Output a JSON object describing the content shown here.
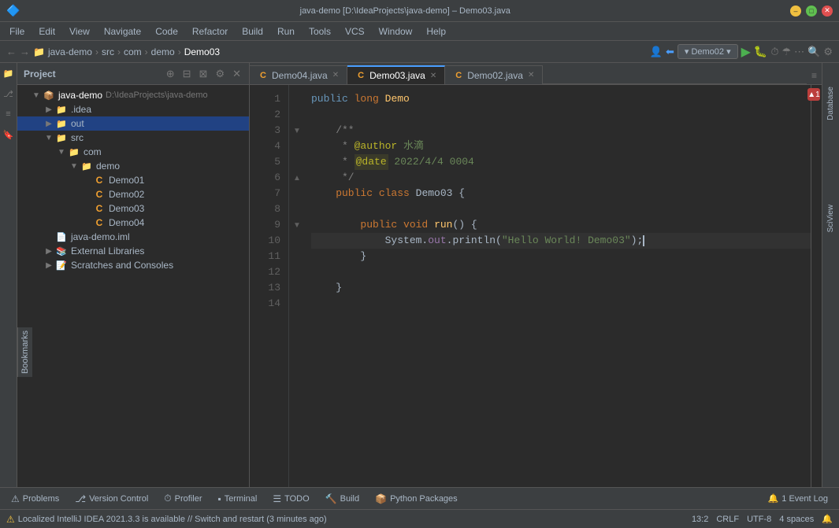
{
  "titleBar": {
    "title": "java-demo [D:\\IdeaProjects\\java-demo] – Demo03.java",
    "appName": "IntelliJ IDEA"
  },
  "menuBar": {
    "items": [
      "File",
      "Edit",
      "View",
      "Navigate",
      "Code",
      "Refactor",
      "Build",
      "Run",
      "Tools",
      "VCS",
      "Window",
      "Help"
    ]
  },
  "navBar": {
    "breadcrumb": [
      "java-demo",
      "src",
      "com",
      "demo",
      "Demo03"
    ],
    "separators": [
      ">",
      ">",
      ">",
      ">"
    ],
    "config": "Demo02",
    "buttons": {
      "run": "▶",
      "debug": "🐛",
      "profile": "⏱",
      "coverage": "☂"
    }
  },
  "projectPanel": {
    "title": "Project",
    "root": "java-demo",
    "rootPath": "D:\\IdeaProjects\\java-demo",
    "items": [
      {
        "level": 1,
        "label": ".idea",
        "type": "folder",
        "expanded": false
      },
      {
        "level": 1,
        "label": "out",
        "type": "folder",
        "expanded": false,
        "selected": true
      },
      {
        "level": 1,
        "label": "src",
        "type": "folder",
        "expanded": true
      },
      {
        "level": 2,
        "label": "com",
        "type": "folder",
        "expanded": true
      },
      {
        "level": 3,
        "label": "demo",
        "type": "folder",
        "expanded": true
      },
      {
        "level": 4,
        "label": "Demo01",
        "type": "java"
      },
      {
        "level": 4,
        "label": "Demo02",
        "type": "java"
      },
      {
        "level": 4,
        "label": "Demo03",
        "type": "java"
      },
      {
        "level": 4,
        "label": "Demo04",
        "type": "java"
      },
      {
        "level": 1,
        "label": "java-demo.iml",
        "type": "iml"
      },
      {
        "level": 1,
        "label": "External Libraries",
        "type": "lib",
        "expanded": false
      },
      {
        "level": 1,
        "label": "Scratches and Consoles",
        "type": "folder",
        "expanded": false
      }
    ]
  },
  "tabs": [
    {
      "label": "Demo04.java",
      "icon": "java",
      "active": false,
      "closable": true
    },
    {
      "label": "Demo03.java",
      "icon": "java",
      "active": true,
      "closable": true
    },
    {
      "label": "Demo02.java",
      "icon": "java",
      "active": false,
      "closable": true
    }
  ],
  "editor": {
    "filename": "Demo03.java",
    "lines": [
      {
        "num": 1,
        "text": "    ",
        "tokens": [
          {
            "type": "plain",
            "text": "    "
          }
        ],
        "fold": false
      },
      {
        "num": 2,
        "text": "",
        "tokens": [],
        "fold": false
      },
      {
        "num": 3,
        "text": "    /**",
        "tokens": [
          {
            "type": "comment",
            "text": "    /**"
          }
        ],
        "fold": true
      },
      {
        "num": 4,
        "text": "     * @author 水滴",
        "tokens": [
          {
            "type": "comment",
            "text": "     * "
          },
          {
            "type": "anno",
            "text": "@author"
          },
          {
            "type": "anno-val",
            "text": " 水滴"
          }
        ],
        "fold": false
      },
      {
        "num": 5,
        "text": "     * @date 2022/4/4 0004",
        "tokens": [
          {
            "type": "comment",
            "text": "     * "
          },
          {
            "type": "anno-hl",
            "text": "@date"
          },
          {
            "type": "anno-val",
            "text": " 2022/4/4 0004"
          }
        ],
        "fold": false
      },
      {
        "num": 6,
        "text": "     */",
        "tokens": [
          {
            "type": "comment",
            "text": "     */"
          }
        ],
        "fold": true
      },
      {
        "num": 7,
        "text": "    public class Demo03 {",
        "tokens": [
          {
            "type": "plain",
            "text": "    "
          },
          {
            "type": "kw",
            "text": "public"
          },
          {
            "type": "plain",
            "text": " "
          },
          {
            "type": "kw",
            "text": "class"
          },
          {
            "type": "plain",
            "text": " Demo03 {"
          }
        ],
        "fold": false
      },
      {
        "num": 8,
        "text": "",
        "tokens": [],
        "fold": false
      },
      {
        "num": 9,
        "text": "        public void run() {",
        "tokens": [
          {
            "type": "plain",
            "text": "        "
          },
          {
            "type": "kw",
            "text": "public"
          },
          {
            "type": "plain",
            "text": " "
          },
          {
            "type": "kw",
            "text": "void"
          },
          {
            "type": "plain",
            "text": " "
          },
          {
            "type": "method",
            "text": "run"
          },
          {
            "type": "plain",
            "text": "() {"
          }
        ],
        "fold": true
      },
      {
        "num": 10,
        "text": "            System.out.println(\"Hello World! Demo03\");",
        "tokens": [
          {
            "type": "plain",
            "text": "            System."
          },
          {
            "type": "field",
            "text": "out"
          },
          {
            "type": "plain",
            "text": ".println("
          },
          {
            "type": "string",
            "text": "\"Hello World! Demo03\""
          },
          {
            "type": "plain",
            "text": ");"
          }
        ],
        "fold": false
      },
      {
        "num": 11,
        "text": "        }",
        "tokens": [
          {
            "type": "plain",
            "text": "        }"
          }
        ],
        "fold": false
      },
      {
        "num": 12,
        "text": "",
        "tokens": [],
        "fold": false
      },
      {
        "num": 13,
        "text": "    }",
        "tokens": [
          {
            "type": "plain",
            "text": "    }"
          }
        ],
        "fold": false
      },
      {
        "num": 14,
        "text": "",
        "tokens": [],
        "fold": false
      }
    ],
    "cursorLine": 10,
    "cursorCol": "3:2"
  },
  "rightPanel": {
    "labels": [
      "Database",
      "SciView"
    ]
  },
  "bottomToolbar": {
    "items": [
      {
        "label": "Problems",
        "icon": "⚠"
      },
      {
        "label": "Version Control",
        "icon": "⎇"
      },
      {
        "label": "Profiler",
        "icon": "⏱"
      },
      {
        "label": "Terminal",
        "icon": "▪"
      },
      {
        "label": "TODO",
        "icon": "☰"
      },
      {
        "label": "Build",
        "icon": "🔨"
      },
      {
        "label": "Python Packages",
        "icon": "📦"
      }
    ],
    "eventLog": "1 Event Log"
  },
  "statusBar": {
    "message": "Localized IntelliJ IDEA 2021.3.3 is available // Switch and restart (3 minutes ago)",
    "position": "13:2",
    "lineEnding": "CRLF",
    "encoding": "UTF-8",
    "indent": "4 spaces"
  },
  "errorStripe": {
    "count": "▲ 1"
  },
  "bookmarksLabel": "Bookmarks",
  "structureLabel": "Structure"
}
